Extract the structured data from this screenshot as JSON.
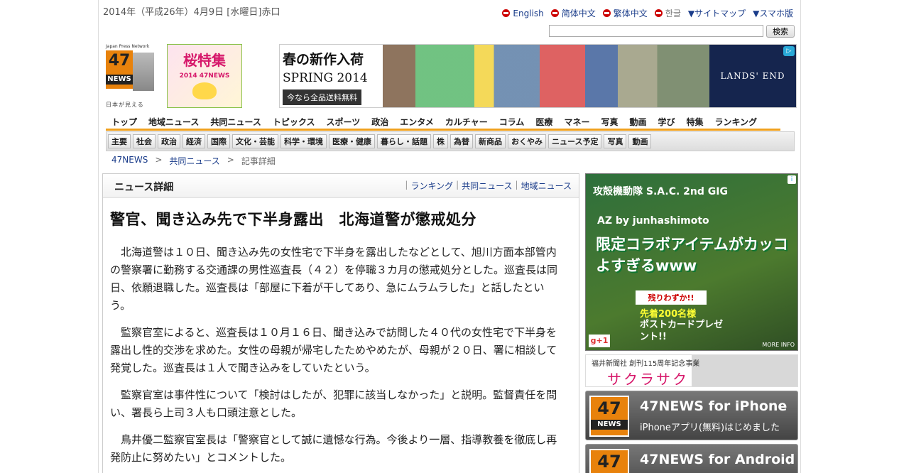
{
  "header": {
    "date": "2014年（平成26年）4月9日 [水曜日]赤口",
    "languages": [
      "English",
      "简体中文",
      "繁体中文",
      "한글"
    ],
    "sitemap": "▼サイトマップ",
    "smartphone": "▼スマホ版",
    "search_placeholder": "",
    "search_button": "検索"
  },
  "logo": {
    "network": "Japan Press Network",
    "number": "47",
    "news": "NEWS",
    "tagline": "日本が見える"
  },
  "sakura_banner": {
    "title": "桜特集",
    "subtitle": "2014 47NEWS"
  },
  "ad_top": {
    "line1": "春の新作入荷",
    "line2": "SPRING 2014",
    "line3": "今なら全品送料無料",
    "brand": "LANDS' END"
  },
  "global_nav": [
    "トップ",
    "地域ニュース",
    "共同ニュース",
    "トピックス",
    "スポーツ",
    "政治",
    "エンタメ",
    "カルチャー",
    "コラム",
    "医療",
    "マネー",
    "写真",
    "動画",
    "学び",
    "特集",
    "ランキング"
  ],
  "sub_nav": [
    "主要",
    "社会",
    "政治",
    "経済",
    "国際",
    "文化・芸能",
    "科学・環境",
    "医療・健康",
    "暮らし・話題",
    "株",
    "為替",
    "新商品",
    "おくやみ",
    "ニュース予定",
    "写真",
    "動画"
  ],
  "breadcrumb": [
    "47NEWS",
    "共同ニュース",
    "記事詳細"
  ],
  "panel": {
    "title": "ニュース詳細",
    "links": [
      "ランキング",
      "共同ニュース",
      "地域ニュース"
    ]
  },
  "article": {
    "title": "警官、聞き込み先で下半身露出　北海道警が懲戒処分",
    "paragraphs": [
      "北海道警は１０日、聞き込み先の女性宅で下半身を露出したなどとして、旭川方面本部管内の警察署に勤務する交通課の男性巡査長（４２）を停職３カ月の懲戒処分とした。巡査長は同日、依願退職した。巡査長は「部屋に下着が干してあり、急にムラムラした」と話したという。",
      "監察官室によると、巡査長は１０月１６日、聞き込みで訪問した４０代の女性宅で下半身を露出し性的交渉を求めた。女性の母親が帰宅したためやめたが、母親が２０日、署に相談して発覚した。巡査長は１人で聞き込みをしていたという。",
      "監察官室は事件性について「検討はしたが、犯罪に該当しなかった」と説明。監督責任を問い、署長ら上司３人も口頭注意とした。",
      "鳥井優二監察官室長は「警察官として誠に遺憾な行為。今後より一層、指導教養を徹底し再発防止に努めたい」とコメントした。"
    ]
  },
  "side_ad": {
    "title": "攻殻機動隊 S.A.C. 2nd GIG",
    "collab": "AZ by junhashimoto",
    "headline": "限定コラボアイテムがカッコよすぎるwww",
    "badge": "残りわずか!!",
    "offer1": "先着200名様",
    "offer2": "ポストカードプレゼント!!",
    "gplus": "g+1",
    "more": "MORE INFO"
  },
  "sakura_saku": {
    "sponsor": "福井新聞社 創刊115周年記念事業",
    "title": "サクラサク"
  },
  "apps": [
    {
      "name": "47NEWS for iPhone",
      "desc": "iPhoneアプリ(無料)はじめました"
    },
    {
      "name": "47NEWS for Android",
      "desc": ""
    }
  ]
}
